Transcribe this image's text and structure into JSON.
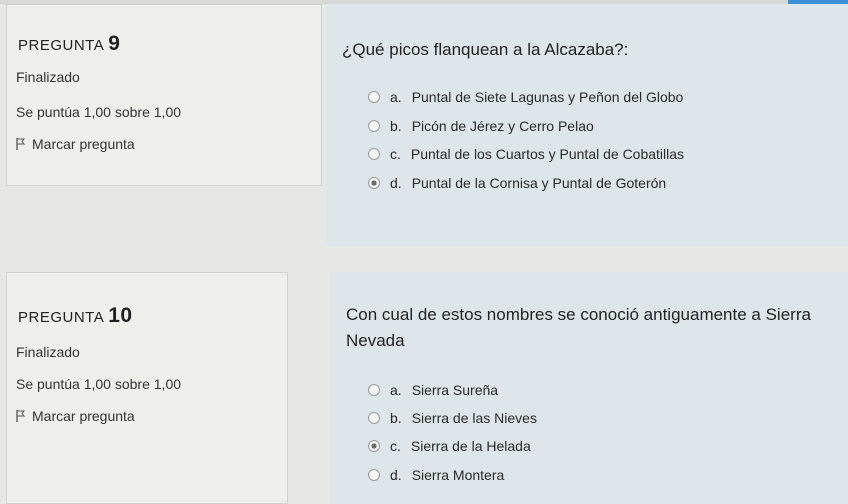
{
  "questions": [
    {
      "prefix": "PREGUNTA",
      "number": "9",
      "status": "Finalizado",
      "grade": "Se puntúa 1,00 sobre 1,00",
      "flag_label": "Marcar pregunta",
      "text": "¿Qué picos flanquean a la Alcazaba?:",
      "options": [
        {
          "letter": "a.",
          "text": "Puntal de Siete Lagunas y Peñon del Globo"
        },
        {
          "letter": "b.",
          "text": "Picón de Jérez y Cerro Pelao"
        },
        {
          "letter": "c.",
          "text": "Puntal de los Cuartos y Puntal de Cobatillas"
        },
        {
          "letter": "d.",
          "text": "Puntal de la Cornisa y Puntal de Goterón"
        }
      ],
      "selected": "d."
    },
    {
      "prefix": "PREGUNTA",
      "number": "10",
      "status": "Finalizado",
      "grade": "Se puntúa 1,00 sobre 1,00",
      "flag_label": "Marcar pregunta",
      "text_line1": "Con cual de estos nombres se conoció antiguamente a Sierra",
      "text_line2": "Nevada",
      "options": [
        {
          "letter": "a.",
          "text": "Sierra Sureña"
        },
        {
          "letter": "b.",
          "text": "Sierra de las Nieves"
        },
        {
          "letter": "c.",
          "text": "Sierra de la Helada"
        },
        {
          "letter": "d.",
          "text": "Sierra Montera"
        }
      ],
      "selected": "c."
    }
  ],
  "icons": {
    "flag": "flag-icon",
    "radio": "radio-button"
  },
  "colors": {
    "info_bg": "#efefec",
    "content_bg": "#dde6ea",
    "accent": "#3a8fd6"
  }
}
